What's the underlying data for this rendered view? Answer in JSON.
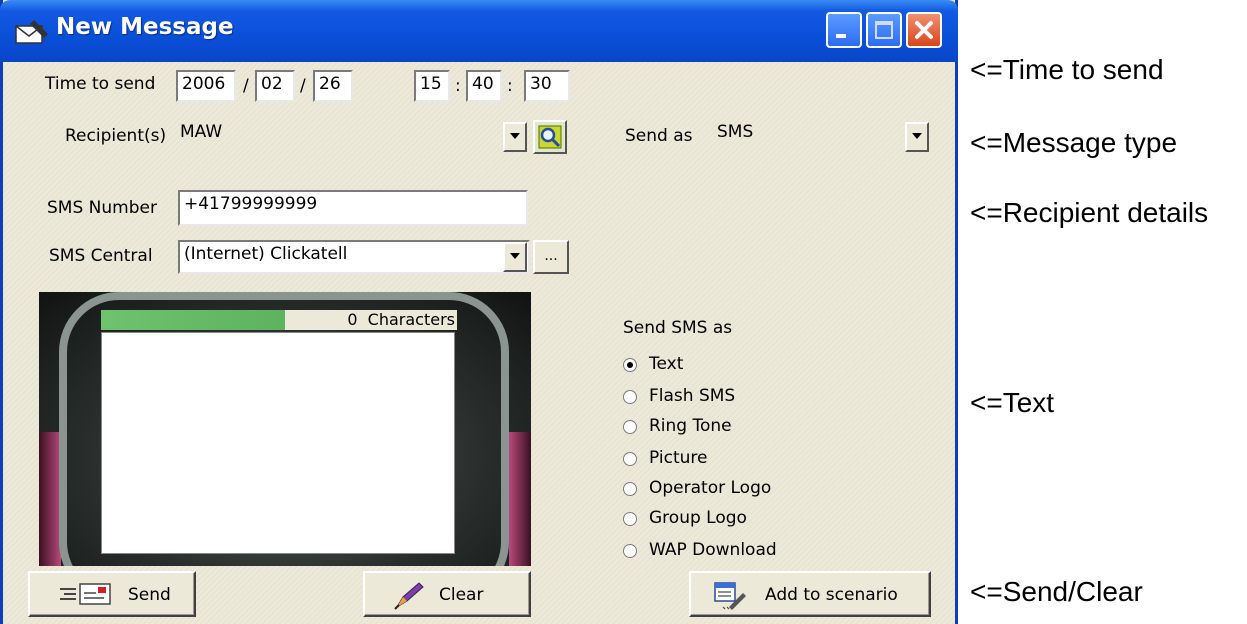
{
  "window": {
    "title": "New Message",
    "title_icon": "envelope-pen-icon"
  },
  "form": {
    "time_label": "Time to send",
    "date_year": "2006",
    "date_month": "02",
    "date_day": "26",
    "date_sep": "/",
    "time_hour": "15",
    "time_minute": "40",
    "time_second": "30",
    "time_sep": ":",
    "recipient_label": "Recipient(s)",
    "recipient_value": "MAW",
    "send_as_label": "Send as",
    "send_as_value": "SMS",
    "sms_number_label": "SMS Number",
    "sms_number_value": "+41799999999",
    "sms_central_label": "SMS Central",
    "sms_central_value": "(Internet) Clickatell",
    "more_button": "..."
  },
  "message": {
    "char_count": "0",
    "char_label": "Characters"
  },
  "send_sms_as": {
    "label": "Send SMS as",
    "options": [
      "Text",
      "Flash SMS",
      "Ring Tone",
      "Picture",
      "Operator Logo",
      "Group Logo",
      "WAP Download"
    ],
    "selected": "Text"
  },
  "buttons": {
    "send": "Send",
    "clear": "Clear",
    "add_to_scenario": "Add to scenario"
  },
  "annotations": {
    "time": "<=Time to send",
    "type": "<=Message type",
    "recipient": "<=Recipient details",
    "text": "<=Text",
    "send_clear": "<=Send/Clear"
  }
}
